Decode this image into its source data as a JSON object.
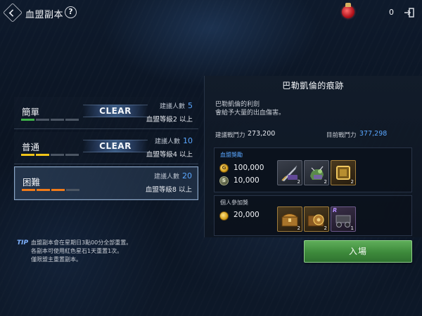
{
  "header": {
    "title": "血盟副本",
    "help_symbol": "?",
    "currency_value": "0"
  },
  "difficulties": [
    {
      "name": "簡單",
      "clear_label": "CLEAR",
      "rec_label": "建議人數",
      "rec_count": "5",
      "level_req": "血盟等級2 以上",
      "bar_color": "#3fb24a",
      "bar_filled": 1,
      "selected": false
    },
    {
      "name": "普通",
      "clear_label": "CLEAR",
      "rec_label": "建議人數",
      "rec_count": "10",
      "level_req": "血盟等級4 以上",
      "bar_color": "#f0c419",
      "bar_filled": 2,
      "selected": false
    },
    {
      "name": "困難",
      "clear_label": "",
      "rec_label": "建議人數",
      "rec_count": "20",
      "level_req": "血盟等級8 以上",
      "bar_color": "#f07b1a",
      "bar_filled": 3,
      "selected": true
    }
  ],
  "tip": {
    "label": "TIP",
    "lines": [
      "血盟副本會在星期日3點00分全部重置。",
      "各副本可使用紅色星石1天重置1次。",
      "僅限盟主重置副本。"
    ]
  },
  "dungeon": {
    "title": "巴勒凱倫的痕跡",
    "desc_line1": "巴勒凱倫的利劍",
    "desc_line2": "會給予大量的出血傷害。",
    "rec_power_label": "建議戰鬥力",
    "rec_power_value": "273,200",
    "cur_power_label": "目前戰鬥力",
    "cur_power_value": "377,298",
    "power_value_color": "#5aa7ff"
  },
  "clan_reward": {
    "title": "血盟獎勵",
    "title_color": "#5aa7ff",
    "currencies": [
      {
        "icon": "gold-coin-icon",
        "glyph": "G",
        "amount": "100,000"
      },
      {
        "icon": "clan-coin-icon",
        "glyph": "S",
        "amount": "10,000"
      }
    ],
    "items": [
      {
        "icon": "weapon-item-icon",
        "count": "2"
      },
      {
        "icon": "mount-item-icon",
        "count": "2"
      },
      {
        "icon": "golden-frame-item-icon",
        "count": "2"
      }
    ]
  },
  "personal_reward": {
    "title": "個人參加獎",
    "title_color": "#c7ccd4",
    "currencies": [
      {
        "icon": "gold-coin-icon",
        "amount": "20,000"
      }
    ],
    "items": [
      {
        "icon": "treasure-chest-icon",
        "count": "2"
      },
      {
        "icon": "shield-chest-icon",
        "count": "2"
      },
      {
        "icon": "cart-item-icon",
        "count": "1",
        "rarity": "R"
      }
    ]
  },
  "enter_button": {
    "label": "入場"
  }
}
